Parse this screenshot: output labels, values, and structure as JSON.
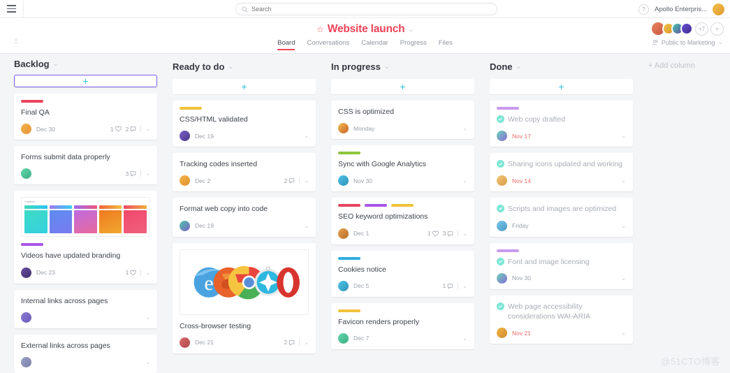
{
  "topbar": {
    "menu_icon": "hamburger-icon",
    "search": {
      "placeholder": "Search",
      "value": "",
      "icon": "search-icon"
    },
    "help_label": "?",
    "org_name": "Apollo Enterpris..."
  },
  "board_header": {
    "star_icon": "star-icon",
    "title": "Website launch",
    "title_caret": "⌄",
    "tabs": [
      {
        "label": "Board",
        "active": true
      },
      {
        "label": "Conversations",
        "active": false
      },
      {
        "label": "Calendar",
        "active": false
      },
      {
        "label": "Progress",
        "active": false
      },
      {
        "label": "Files",
        "active": false
      }
    ],
    "members_overflow": "+7",
    "members_add": "+",
    "privacy_label": "Public to Marketing",
    "privacy_caret": "⌄"
  },
  "add_column_label": "+ Add column",
  "watermark": "@51CTO博客",
  "colors": {
    "accent_red": "#ef4458",
    "chip_red": "#e8455f",
    "chip_purple": "#a855e8",
    "chip_yellow": "#f0c23a",
    "chip_green": "#8cc63f",
    "chip_blue": "#2eaee0",
    "add_plus": "#2ec5d8",
    "done_check": "#7fe6d6",
    "overdue": "#f06a6a"
  },
  "columns": [
    {
      "title": "Backlog",
      "caret": "⌄",
      "add_label": "+",
      "add_selected": true,
      "cards": [
        {
          "title": "Final QA",
          "chips": [
            "#e8455f"
          ],
          "date": "Dec 30",
          "date_overdue": false,
          "avatar_colors": [
            "#f2b544",
            "#e8913c"
          ],
          "likes": "1",
          "comments": "2",
          "done": false
        },
        {
          "title": "Forms submit data properly",
          "chips": [],
          "date": "",
          "date_overdue": false,
          "avatar_colors": [
            "#5fd6a8",
            "#3fae86"
          ],
          "likes": "",
          "comments": "3",
          "done": false
        },
        {
          "title": "Videos have updated branding",
          "chips": [
            "#a855e8"
          ],
          "date": "Dec 23",
          "date_overdue": false,
          "avatar_colors": [
            "#6b4fa8",
            "#3d2d66"
          ],
          "likes": "1",
          "comments": "",
          "done": false,
          "media": "gradients",
          "media_label": "Gradients"
        },
        {
          "title": "Internal links across pages",
          "chips": [],
          "date": "",
          "date_overdue": false,
          "avatar_colors": [
            "#8b7ad6",
            "#6b5ab5"
          ],
          "likes": "",
          "comments": "",
          "done": false
        },
        {
          "title": "External links across pages",
          "chips": [],
          "date": "",
          "date_overdue": false,
          "avatar_colors": [
            "#9aa0c8",
            "#7a80a8"
          ],
          "likes": "",
          "comments": "",
          "done": false
        }
      ]
    },
    {
      "title": "Ready to do",
      "caret": "⌄",
      "add_label": "+",
      "add_selected": false,
      "cards": [
        {
          "title": "CSS/HTML validated",
          "chips": [
            "#f0c23a"
          ],
          "date": "Dec 19",
          "date_overdue": false,
          "avatar_colors": [
            "#7a5fc8",
            "#4a3a8a"
          ],
          "likes": "",
          "comments": "",
          "done": false
        },
        {
          "title": "Tracking codes inserted",
          "chips": [],
          "date": "Dec 2",
          "date_overdue": false,
          "avatar_colors": [
            "#f2b544",
            "#e09030"
          ],
          "likes": "",
          "comments": "2",
          "done": false
        },
        {
          "title": "Format web copy into code",
          "chips": [],
          "date": "Dec 19",
          "date_overdue": false,
          "avatar_colors": [
            "#4ec9a8",
            "#7a5fc8"
          ],
          "likes": "",
          "comments": "",
          "done": false
        },
        {
          "title": "Cross-browser testing",
          "chips": [],
          "date": "Dec 21",
          "date_overdue": false,
          "avatar_colors": [
            "#d86a6a",
            "#b04a4a"
          ],
          "likes": "",
          "comments": "2",
          "done": false,
          "media": "browsers"
        }
      ]
    },
    {
      "title": "In progress",
      "caret": "⌄",
      "add_label": "+",
      "add_selected": false,
      "cards": [
        {
          "title": "CSS is optimized",
          "chips": [],
          "date": "Monday",
          "date_overdue": false,
          "avatar_colors": [
            "#f2c04a",
            "#c8602e"
          ],
          "likes": "",
          "comments": "",
          "done": false
        },
        {
          "title": "Sync with Google Analytics",
          "chips": [
            "#8cc63f"
          ],
          "date": "Nov 30",
          "date_overdue": false,
          "avatar_colors": [
            "#4fc3e8",
            "#2f93b8"
          ],
          "likes": "",
          "comments": "",
          "done": false
        },
        {
          "title": "SEO keyword optimizations",
          "chips": [
            "#e8455f",
            "#a855e8",
            "#f0c23a"
          ],
          "date": "Dec 1",
          "date_overdue": false,
          "avatar_colors": [
            "#e8a24a",
            "#b86a2a"
          ],
          "likes": "1",
          "comments": "3",
          "done": false
        },
        {
          "title": "Cookies notice",
          "chips": [
            "#2eaee0"
          ],
          "date": "Dec 5",
          "date_overdue": false,
          "avatar_colors": [
            "#4fc3e8",
            "#2f93b8"
          ],
          "likes": "",
          "comments": "1",
          "done": false
        },
        {
          "title": "Favicon renders properly",
          "chips": [
            "#f0c23a"
          ],
          "date": "Dec 7",
          "date_overdue": false,
          "avatar_colors": [
            "#5fd6a8",
            "#3fae86"
          ],
          "likes": "",
          "comments": "",
          "done": false
        }
      ]
    },
    {
      "title": "Done",
      "caret": "⌄",
      "add_label": "+",
      "add_selected": false,
      "cards": [
        {
          "title": "Web copy drafted",
          "chips": [
            "#c89af0"
          ],
          "date": "Nov 17",
          "date_overdue": true,
          "avatar_colors": [
            "#6ad6b8",
            "#8a6ad6"
          ],
          "likes": "",
          "comments": "",
          "done": true
        },
        {
          "title": "Sharing icons updated and working",
          "chips": [],
          "date": "Nov 14",
          "date_overdue": true,
          "avatar_colors": [
            "#f2c878",
            "#d89a48"
          ],
          "likes": "",
          "comments": "",
          "done": true
        },
        {
          "title": "Scripts and images are optimized",
          "chips": [],
          "date": "Friday",
          "date_overdue": false,
          "avatar_colors": [
            "#7ac8e8",
            "#4a98c8"
          ],
          "likes": "",
          "comments": "",
          "done": true
        },
        {
          "title": "Font and image licensing",
          "chips": [
            "#c89af0"
          ],
          "date": "Nov 30",
          "date_overdue": false,
          "avatar_colors": [
            "#6ad6b8",
            "#8a6ad6"
          ],
          "likes": "",
          "comments": "",
          "done": true
        },
        {
          "title": "Web page accessibility considerations WAI-ARIA",
          "chips": [],
          "date": "Nov 21",
          "date_overdue": true,
          "avatar_colors": [
            "#f2b544",
            "#d08a30"
          ],
          "likes": "",
          "comments": "",
          "done": true
        }
      ]
    }
  ],
  "gradients": [
    {
      "bar_from": "#3ddbb8",
      "bar_to": "#29c5f0",
      "sq_from": "#3ddbc4",
      "sq_to": "#35d0e0"
    },
    {
      "bar_from": "#9b7bf0",
      "bar_to": "#35d0f0",
      "sq_from": "#5b8cf0",
      "sq_to": "#7b7bf0"
    },
    {
      "bar_from": "#9b6bf0",
      "bar_to": "#f0567e",
      "sq_from": "#c06ae0",
      "sq_to": "#e86a9b"
    },
    {
      "bar_from": "#f0603e",
      "bar_to": "#f0c23a",
      "sq_from": "#f07a20",
      "sq_to": "#f0a830"
    },
    {
      "bar_from": "#f0486b",
      "bar_to": "#f0b03a",
      "sq_from": "#f0486b",
      "sq_to": "#f0607e"
    }
  ],
  "header_avatars": [
    {
      "colors": [
        "#e8845f",
        "#c8543f"
      ]
    },
    {
      "colors": [
        "#f2c04a",
        "#d89a2a"
      ]
    },
    {
      "colors": [
        "#3fc8a8",
        "#6b4fa8"
      ]
    },
    {
      "colors": [
        "#6b4fd6",
        "#3d2d8a"
      ]
    }
  ],
  "user_avatar": {
    "colors": [
      "#f2c04a",
      "#e09a30"
    ]
  }
}
